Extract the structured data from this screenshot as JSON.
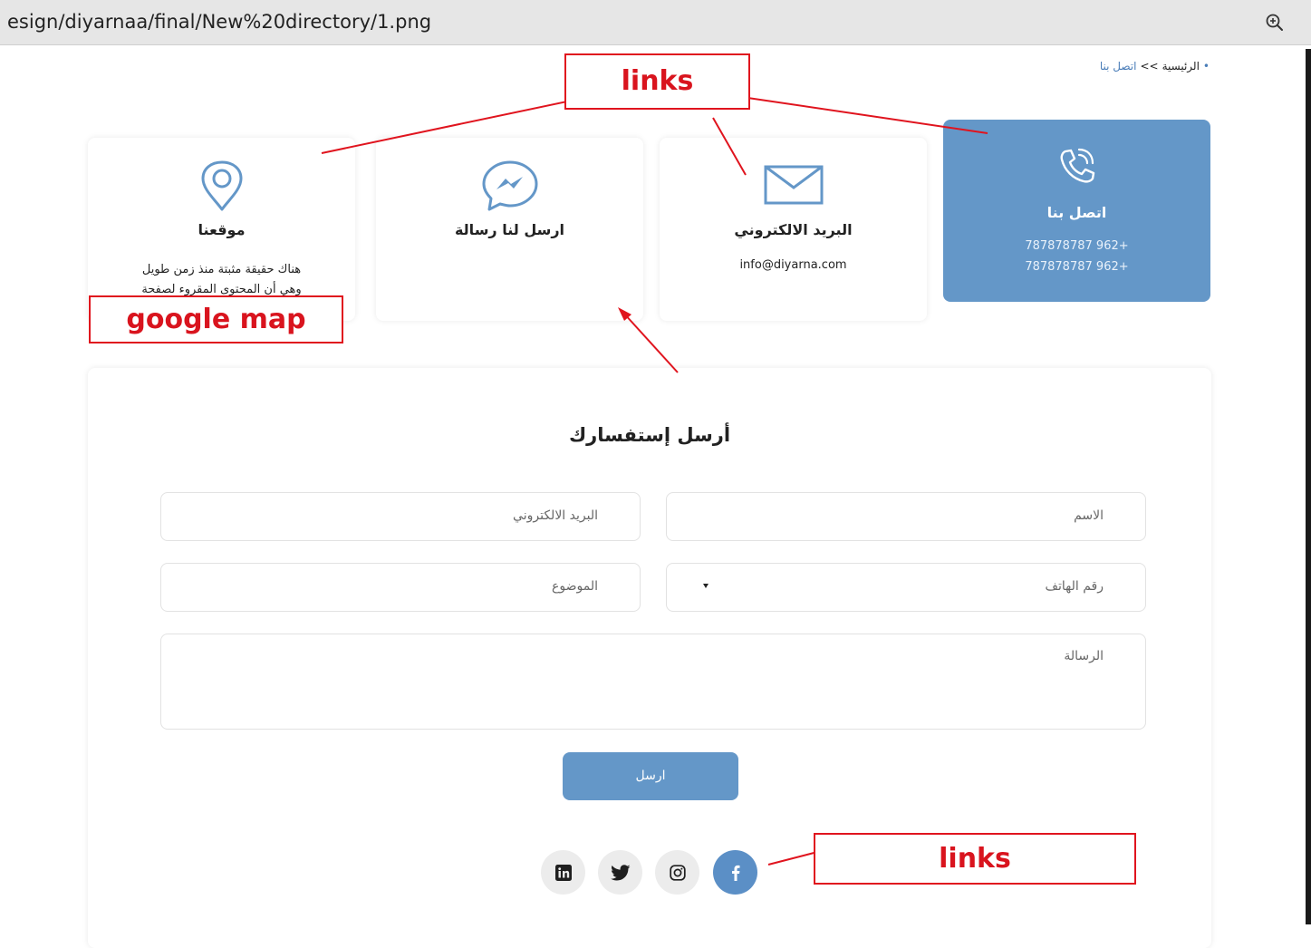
{
  "viewer": {
    "url": "esign/diyarnaa/final/New%20directory/1.png",
    "zoom_icon": "zoom-in-icon"
  },
  "breadcrumb": {
    "bullet": "•",
    "home": "الرئيسية",
    "separator": ">>",
    "current": "اتصل بنا"
  },
  "contact_cards": {
    "location": {
      "icon": "location-pin-icon",
      "title": "موقعنا",
      "line1": "هناك حقيقة مثبتة منذ زمن طويل",
      "line2": "وهي أن المحتوى المقروء لصفحة"
    },
    "messenger": {
      "icon": "messenger-icon",
      "title": "ارسل لنا رسالة"
    },
    "email": {
      "icon": "envelope-icon",
      "title": "البريد الالكتروني",
      "value": "info@diyarna.com"
    },
    "call": {
      "icon": "phone-icon",
      "title": "اتصل بنا",
      "phone1": "+962 787878787",
      "phone2": "+962 787878787"
    }
  },
  "form": {
    "title": "أرسل إستفسارك",
    "name_placeholder": "الاسم",
    "email_placeholder": "البريد الالكتروني",
    "phone_placeholder": "رقم الهاتف",
    "subject_placeholder": "الموضوع",
    "message_placeholder": "الرسالة",
    "submit_label": "ارسل"
  },
  "social": [
    {
      "name": "linkedin",
      "icon": "linkedin-icon"
    },
    {
      "name": "twitter",
      "icon": "twitter-icon"
    },
    {
      "name": "instagram",
      "icon": "instagram-icon"
    },
    {
      "name": "facebook",
      "icon": "facebook-icon"
    }
  ],
  "annotations": {
    "links_top": "links",
    "google_map": "google map",
    "links_bottom": "links"
  },
  "colors": {
    "accent": "#6497c8",
    "annotation_red": "#e0141e"
  }
}
